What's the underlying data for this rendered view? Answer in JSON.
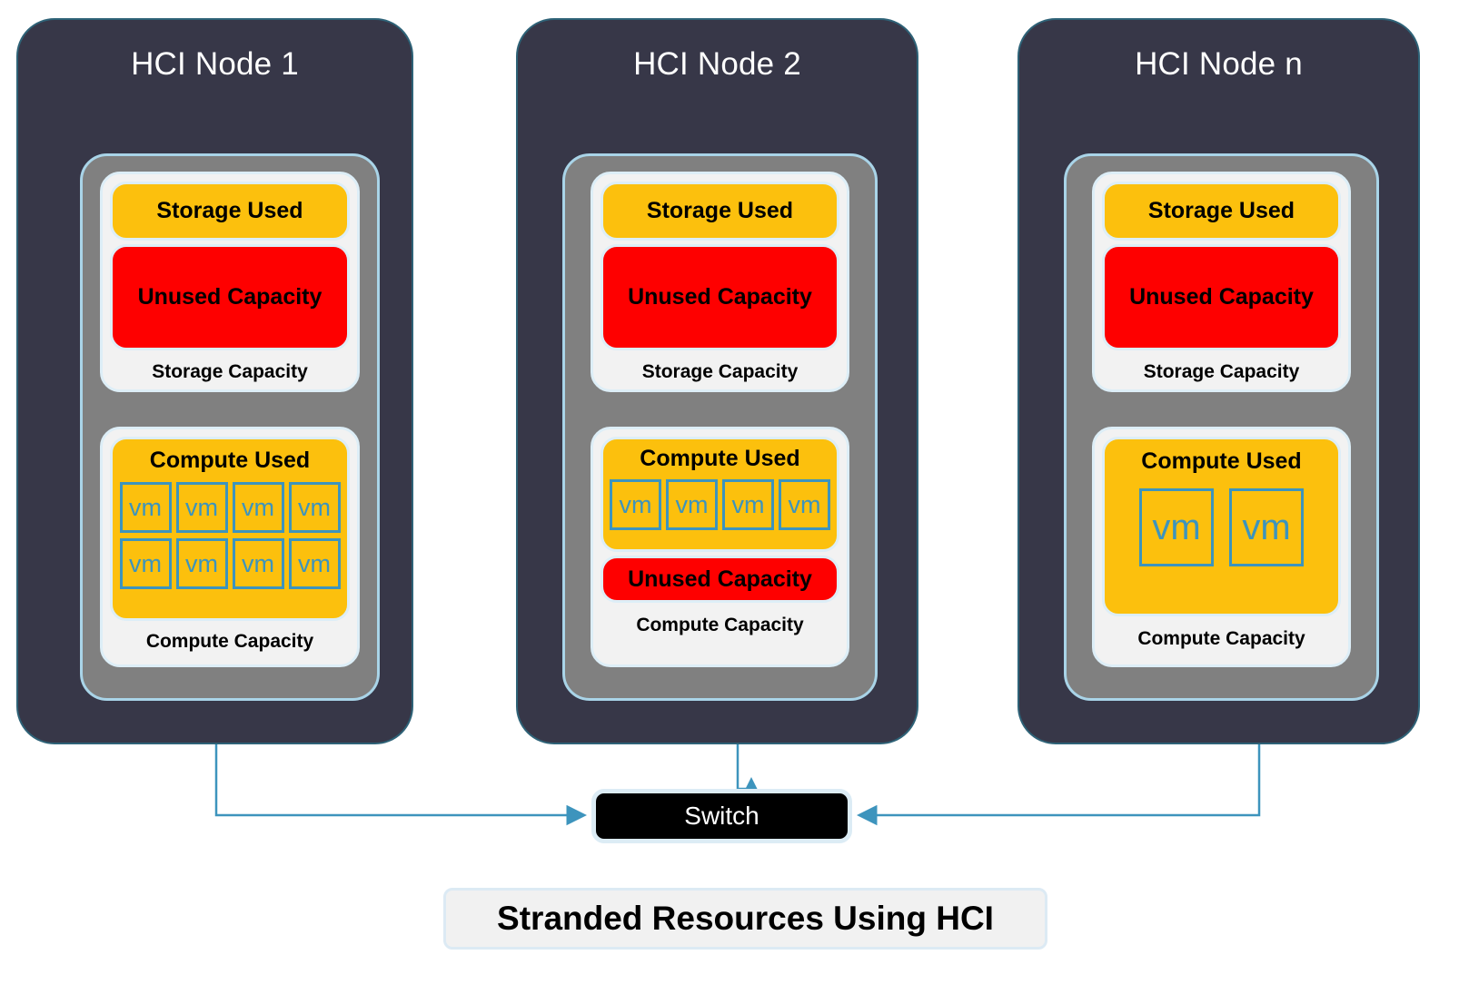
{
  "diagram": {
    "caption": "Stranded Resources Using HCI",
    "switch_label": "Switch",
    "colors": {
      "node_bg": "#373748",
      "node_border": "#2e6277",
      "chassis": "#808080",
      "chassis_border": "#a9d4e8",
      "capacity_card": "#f2f2f2",
      "used": "#fcc00d",
      "unused": "#fe0000",
      "vm_outline": "#3d94bd",
      "connector": "#3d94bd",
      "switch_bg": "#000000",
      "caption_bg": "#f1f1f1"
    },
    "nodes": [
      {
        "title": "HCI Node 1",
        "storage": {
          "capacity_label": "Storage Capacity",
          "used_label": "Storage Used",
          "unused_label": "Unused Capacity"
        },
        "compute": {
          "capacity_label": "Compute Capacity",
          "used_label": "Compute Used",
          "unused_label": "",
          "has_unused": false,
          "vm_label": "vm",
          "vm_size": "small",
          "vm_rows": [
            4,
            4
          ],
          "vm_count": 8
        }
      },
      {
        "title": "HCI Node 2",
        "storage": {
          "capacity_label": "Storage Capacity",
          "used_label": "Storage Used",
          "unused_label": "Unused Capacity"
        },
        "compute": {
          "capacity_label": "Compute Capacity",
          "used_label": "Compute Used",
          "unused_label": "Unused Capacity",
          "has_unused": true,
          "vm_label": "vm",
          "vm_size": "small",
          "vm_rows": [
            4
          ],
          "vm_count": 4
        }
      },
      {
        "title": "HCI Node n",
        "storage": {
          "capacity_label": "Storage Capacity",
          "used_label": "Storage Used",
          "unused_label": "Unused Capacity"
        },
        "compute": {
          "capacity_label": "Compute Capacity",
          "used_label": "Compute Used",
          "unused_label": "",
          "has_unused": false,
          "vm_label": "vm",
          "vm_size": "large",
          "vm_rows": [
            2
          ],
          "vm_count": 2
        }
      }
    ]
  }
}
